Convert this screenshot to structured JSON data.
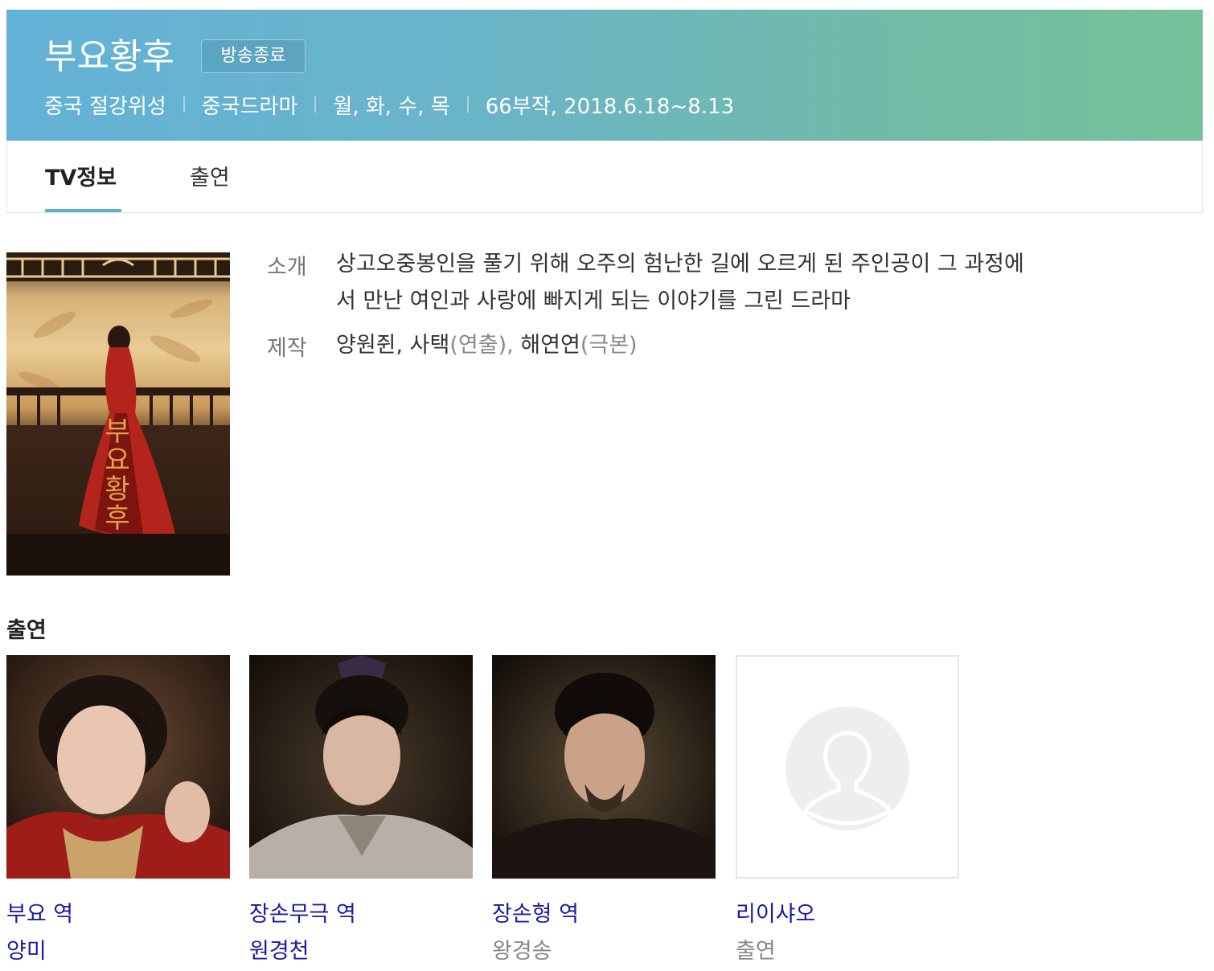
{
  "header": {
    "title": "부요황후",
    "badge": "방송종료",
    "meta": [
      "중국 절강위성",
      "중국드라마",
      "월, 화, 수, 목",
      "66부작, 2018.6.18~8.13"
    ]
  },
  "tabs": [
    {
      "label": "TV정보",
      "active": true
    },
    {
      "label": "출연",
      "active": false
    }
  ],
  "info": {
    "intro_label": "소개",
    "intro_line1": "상고오중봉인을 풀기 위해 오주의 험난한 길에 오르게 된 주인공이 그 과정에",
    "intro_line2": "서 만난 여인과 사랑에 빠지게 되는 이야기를 그린 드라마",
    "production_label": "제작",
    "production": {
      "directors": "양원쥔, 사택",
      "director_role": "(연출)",
      "sep": ", ",
      "writer": "해연연",
      "writer_role": "(극본)"
    }
  },
  "poster": {
    "vertical_title": [
      "부",
      "요",
      "황",
      "후"
    ]
  },
  "cast_section_title": "출연",
  "cast": [
    {
      "role": "부요 역",
      "name": "양미",
      "name_is_link": true
    },
    {
      "role": "장손무극 역",
      "name": "원경천",
      "name_is_link": true
    },
    {
      "role": "장손형 역",
      "name": "왕경송",
      "name_is_link": false
    },
    {
      "role": "리이샤오",
      "name": "출연",
      "name_is_link": false
    }
  ],
  "colors": {
    "link": "#1a1aa6",
    "gray": "#888888",
    "tab_accent": "#5eb3c4"
  }
}
